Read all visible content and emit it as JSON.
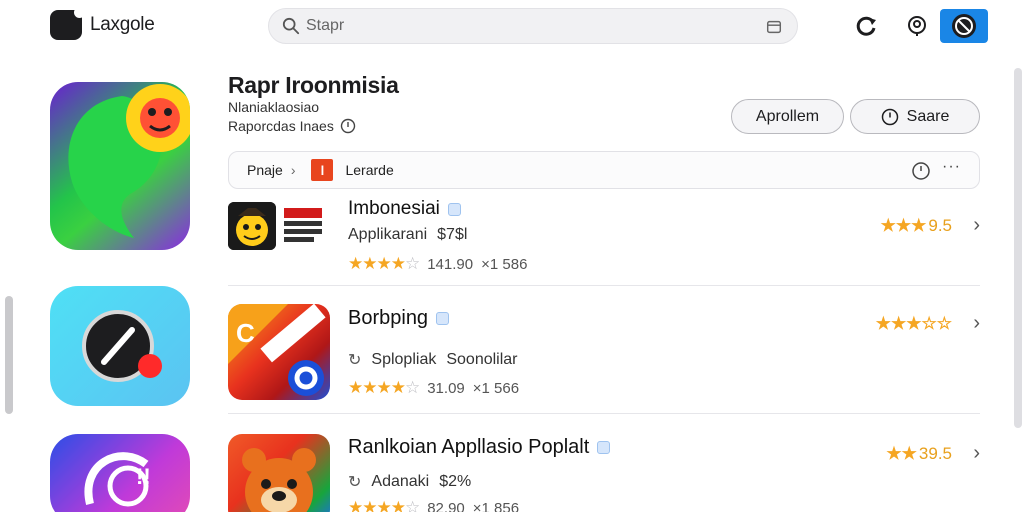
{
  "header": {
    "brand": "Laxgole",
    "search_placeholder": "Stapr",
    "icons": [
      "update-icon",
      "bell-icon",
      "account-icon"
    ]
  },
  "app": {
    "title": "Rapr Iroonmisia",
    "subtitle": "Nlaniaklaosiao",
    "category": "Raporcdas Inaes",
    "apply_label": "Aprollem",
    "share_label": "Saare"
  },
  "filter": {
    "crumb": "Pnaje",
    "tag_letter": "l",
    "label": "Lerarde",
    "more": "···"
  },
  "rows": [
    {
      "name": "Imbonesiai",
      "meta_a": "Applikarani",
      "meta_b": "$7$l",
      "rating_text": "141.90",
      "reviews": "×1 586",
      "score": "9.5"
    },
    {
      "name": "Borbping",
      "meta_a": "Splopliak",
      "meta_b": "Soonolilar",
      "rating_text": "31.09",
      "reviews": "×1 566",
      "score": ""
    },
    {
      "name": "Ranlkoian Appllasio Poplalt",
      "meta_a": "Adanaki",
      "meta_b": "$2%",
      "rating_text": "82.90",
      "reviews": "×1 856",
      "score": "39.5"
    }
  ],
  "colors": {
    "accent_blue": "#1a86e6",
    "star": "#f5a623",
    "tag": "#e8451e"
  }
}
